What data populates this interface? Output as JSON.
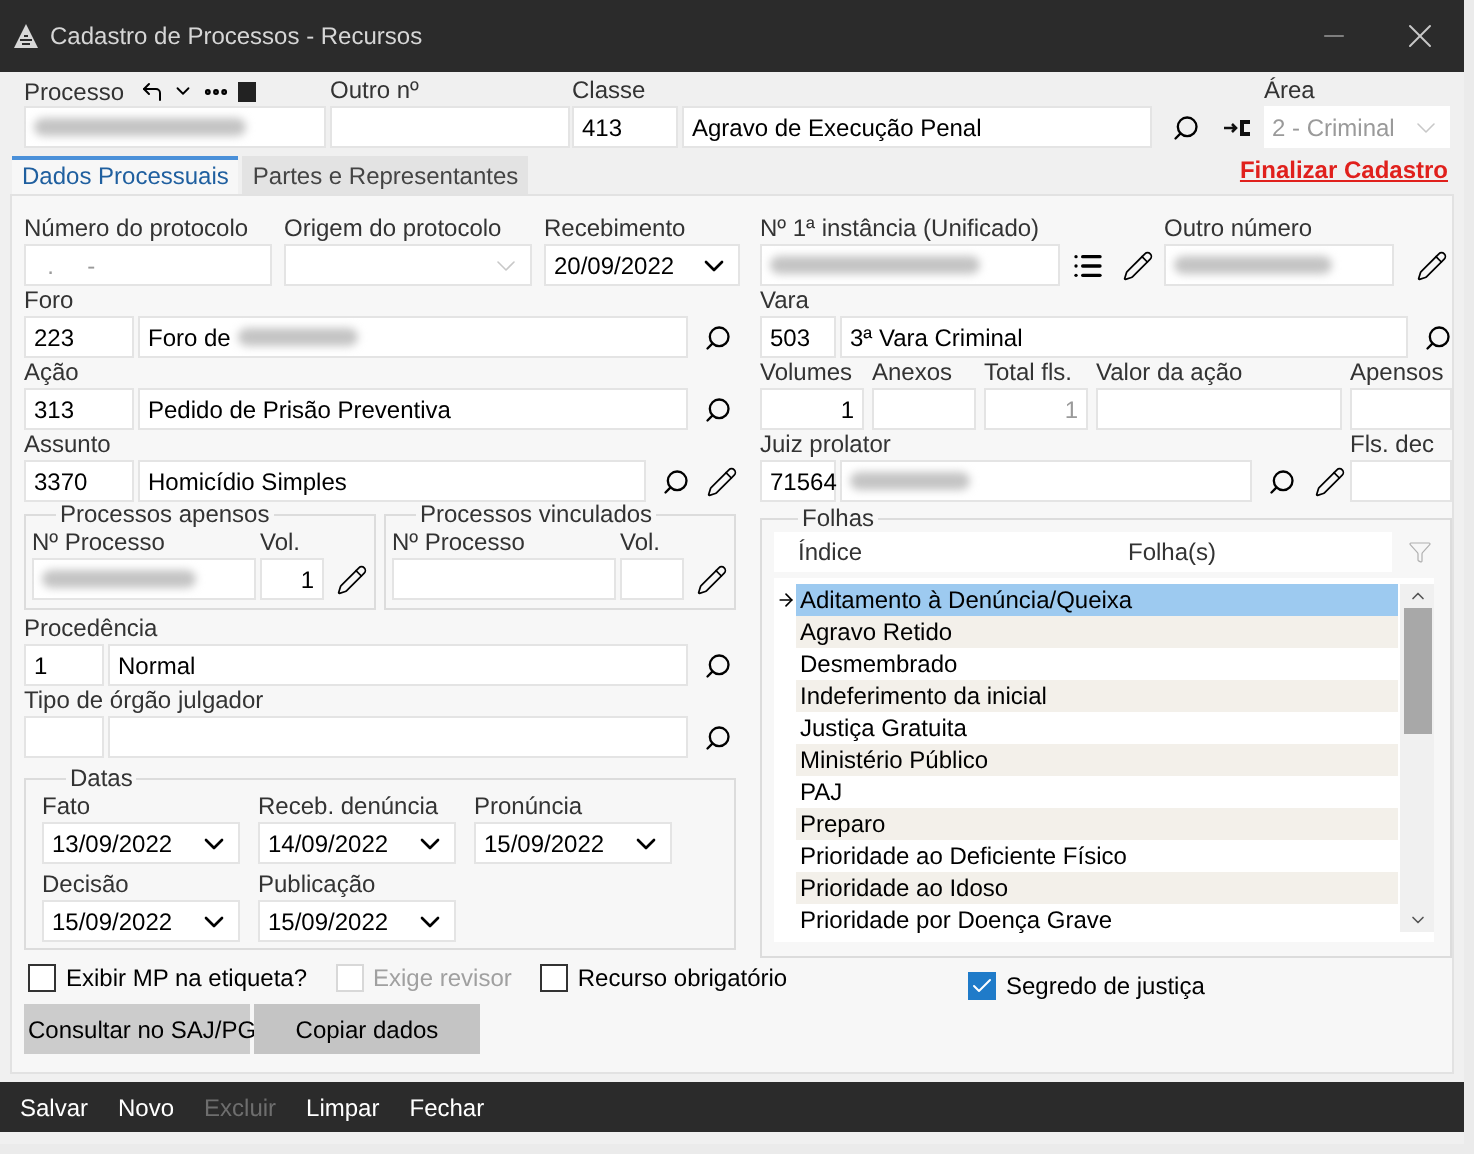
{
  "window": {
    "title": "Cadastro de Processos - Recursos"
  },
  "header": {
    "processo": {
      "label": "Processo",
      "redacted": true
    },
    "outro": {
      "label": "Outro nº"
    },
    "classe": {
      "label": "Classe",
      "code": "413",
      "value": "Agravo de Execução Penal"
    },
    "area": {
      "label": "Área",
      "value": "2 - Criminal",
      "disabled": true
    }
  },
  "tabs": [
    {
      "label": "Dados Processuais",
      "selected": true
    },
    {
      "label": "Partes e Representantes",
      "selected": false
    }
  ],
  "finalize_link": "Finalizar Cadastro",
  "protocolo": {
    "number": {
      "label": "Número do protocolo",
      "placeholder": "  .     -"
    },
    "origem": {
      "label": "Origem do protocolo",
      "disabled": true
    },
    "recebimento": {
      "label": "Recebimento",
      "value": "20/09/2022"
    }
  },
  "foro": {
    "label": "Foro",
    "code": "223",
    "value": "Foro de",
    "redacted": true
  },
  "acao": {
    "label": "Ação",
    "code": "313",
    "value": "Pedido de Prisão Preventiva"
  },
  "assunto": {
    "label": "Assunto",
    "code": "3370",
    "value": "Homicídio Simples"
  },
  "apensos": {
    "title": "Processos apensos",
    "number_label": "Nº Processo",
    "vol_label": "Vol.",
    "vol": "1",
    "redacted": true
  },
  "vinculados": {
    "title": "Processos vinculados",
    "number_label": "Nº Processo",
    "vol_label": "Vol."
  },
  "procedencia": {
    "label": "Procedência",
    "code": "1",
    "value": "Normal"
  },
  "orgao": {
    "label": "Tipo de órgão julgador"
  },
  "datas": {
    "title": "Datas",
    "fields": [
      {
        "label": "Fato",
        "value": "13/09/2022"
      },
      {
        "label": "Receb. denúncia",
        "value": "14/09/2022"
      },
      {
        "label": "Pronúncia",
        "value": "15/09/2022"
      },
      {
        "label": "Decisão",
        "value": "15/09/2022"
      },
      {
        "label": "Publicação",
        "value": "15/09/2022"
      }
    ]
  },
  "checkboxes": [
    {
      "label": "Exibir MP na etiqueta?",
      "checked": false,
      "disabled": false
    },
    {
      "label": "Exige revisor",
      "checked": false,
      "disabled": true
    },
    {
      "label": "Recurso obrigatório",
      "checked": false,
      "disabled": false
    }
  ],
  "buttons": [
    "Consultar no SAJ/PG",
    "Copiar dados"
  ],
  "instancia": {
    "label": "Nº 1ª instância (Unificado)",
    "redacted": true
  },
  "outro_numero": {
    "label": "Outro número",
    "redacted": true
  },
  "vara": {
    "label": "Vara",
    "code": "503",
    "value": "3ª Vara Criminal"
  },
  "counts": [
    {
      "label": "Volumes",
      "value": "1"
    },
    {
      "label": "Anexos"
    },
    {
      "label": "Total fls.",
      "value": "1",
      "disabled": true
    },
    {
      "label": "Valor da ação"
    },
    {
      "label": "Apensos"
    }
  ],
  "juiz": {
    "label": "Juiz prolator",
    "code": "71564",
    "redacted": true
  },
  "fls_dec": {
    "label": "Fls. dec"
  },
  "folhas": {
    "title": "Folhas",
    "columns": [
      "Índice",
      "Folha(s)"
    ],
    "rows": [
      {
        "indice": "Aditamento à Denúncia/Queixa",
        "selected": true
      },
      {
        "indice": "Agravo Retido",
        "selected": false
      },
      {
        "indice": "Desmembrado",
        "selected": false
      },
      {
        "indice": "Indeferimento da inicial",
        "selected": false
      },
      {
        "indice": "Justiça Gratuita",
        "selected": false
      },
      {
        "indice": "Ministério Público",
        "selected": false
      },
      {
        "indice": "PAJ",
        "selected": false
      },
      {
        "indice": "Preparo",
        "selected": false
      },
      {
        "indice": "Prioridade ao Deficiente Físico",
        "selected": false
      },
      {
        "indice": "Prioridade ao Idoso",
        "selected": false
      },
      {
        "indice": "Prioridade por Doença Grave",
        "selected": false
      }
    ]
  },
  "segredo": {
    "label": "Segredo de justiça",
    "checked": true
  },
  "actions": [
    {
      "label": "Salvar",
      "disabled": false
    },
    {
      "label": "Novo",
      "disabled": false
    },
    {
      "label": "Excluir",
      "disabled": true
    },
    {
      "label": "Limpar",
      "disabled": false
    },
    {
      "label": "Fechar",
      "disabled": false
    }
  ]
}
